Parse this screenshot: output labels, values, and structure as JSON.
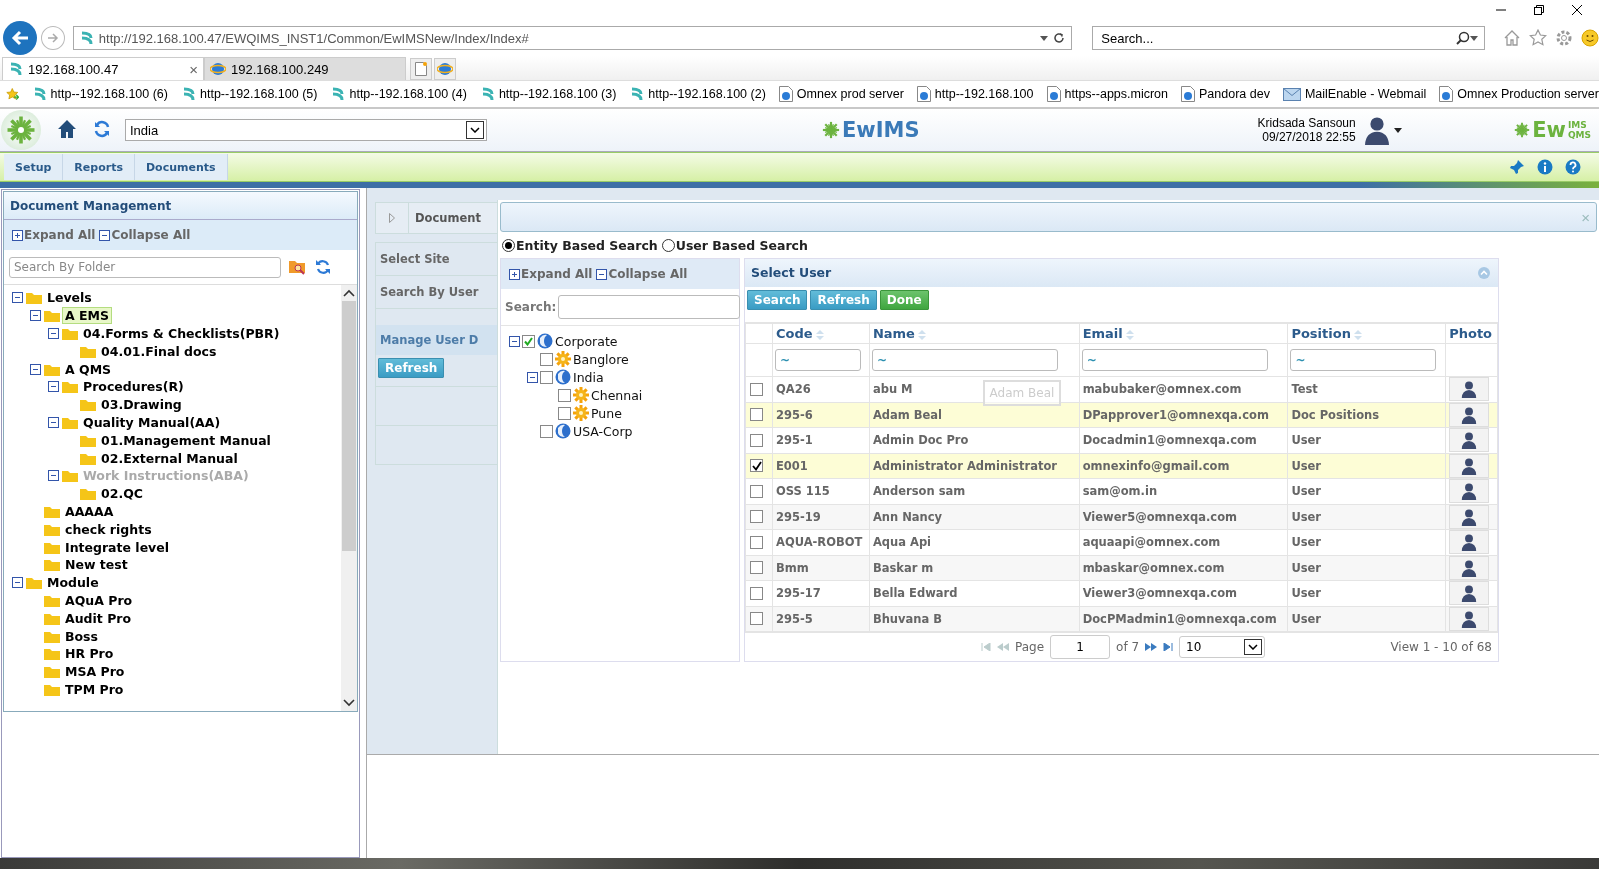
{
  "browser": {
    "address": "http://192.168.100.47/EWQIMS_INST1/Common/EwIMSNew/Index/Index#",
    "search_placeholder": "Search...",
    "tab_close": "×",
    "tabs": [
      {
        "label": "192.168.100.47",
        "selected": true
      },
      {
        "label": "192.168.100.249",
        "selected": false
      }
    ],
    "favorites": [
      {
        "label": "http--192.168.100 (6)",
        "kind": "site"
      },
      {
        "label": "http--192.168.100 (5)",
        "kind": "site"
      },
      {
        "label": "http--192.168.100 (4)",
        "kind": "site"
      },
      {
        "label": "http--192.168.100 (3)",
        "kind": "site"
      },
      {
        "label": "http--192.168.100 (2)",
        "kind": "site"
      },
      {
        "label": "Omnex prod server",
        "kind": "page"
      },
      {
        "label": "http--192.168.100",
        "kind": "page"
      },
      {
        "label": "https--apps.micron",
        "kind": "page"
      },
      {
        "label": "Pandora dev",
        "kind": "page"
      },
      {
        "label": "MailEnable - Webmail",
        "kind": "mail"
      },
      {
        "label": "Omnex Production server",
        "kind": "page"
      }
    ]
  },
  "app_header": {
    "site": "India",
    "logo": "EwIMS",
    "user_name": "Kridsada Sansoun",
    "datetime": "09/27/2018 22:55",
    "corner_logo": {
      "main": "Ew",
      "top": "IMS",
      "bottom": "QMS"
    }
  },
  "menu": [
    {
      "label": "Setup"
    },
    {
      "label": "Reports"
    },
    {
      "label": "Documents"
    }
  ],
  "left_panel": {
    "title": "Document Management",
    "expand_all": "Expand All",
    "collapse_all": "Collapse All",
    "search_placeholder": "Search By Folder",
    "tree": [
      {
        "label": "Levels",
        "selected": false,
        "disabled": false,
        "children": [
          {
            "label": "A EMS",
            "selected": true,
            "disabled": false,
            "children": [
              {
                "label": "04.Forms & Checklists(PBR)",
                "selected": false,
                "disabled": false,
                "children": [
                  {
                    "label": "04.01.Final docs",
                    "selected": false,
                    "disabled": false
                  }
                ]
              }
            ]
          },
          {
            "label": "A QMS",
            "selected": false,
            "disabled": false,
            "children": [
              {
                "label": "Procedures(R)",
                "selected": false,
                "disabled": false,
                "children": [
                  {
                    "label": "03.Drawing",
                    "selected": false,
                    "disabled": false
                  }
                ]
              },
              {
                "label": "Quality Manual(AA)",
                "selected": false,
                "disabled": false,
                "children": [
                  {
                    "label": "01.Management Manual",
                    "selected": false,
                    "disabled": false
                  },
                  {
                    "label": "02.External Manual",
                    "selected": false,
                    "disabled": false
                  }
                ]
              },
              {
                "label": "Work Instructions(ABA)",
                "selected": false,
                "disabled": true,
                "children": [
                  {
                    "label": "02.QC",
                    "selected": false,
                    "disabled": false
                  }
                ]
              }
            ]
          },
          {
            "label": "AAAAA",
            "selected": false,
            "disabled": false
          },
          {
            "label": "check rights",
            "selected": false,
            "disabled": false
          },
          {
            "label": "Integrate level",
            "selected": false,
            "disabled": false
          },
          {
            "label": "New test",
            "selected": false,
            "disabled": false
          }
        ]
      },
      {
        "label": "Module",
        "selected": false,
        "disabled": false,
        "children": [
          {
            "label": "AQuA Pro",
            "selected": false,
            "disabled": false
          },
          {
            "label": "Audit Pro",
            "selected": false,
            "disabled": false
          },
          {
            "label": "Boss",
            "selected": false,
            "disabled": false
          },
          {
            "label": "HR Pro",
            "selected": false,
            "disabled": false
          },
          {
            "label": "MSA Pro",
            "selected": false,
            "disabled": false
          },
          {
            "label": "TPM Pro",
            "selected": false,
            "disabled": false
          }
        ]
      }
    ]
  },
  "side_nav": {
    "header": "Document",
    "items": [
      {
        "label": "Select Site"
      },
      {
        "label": "Search By User"
      }
    ],
    "section": "Manage User D",
    "refresh": "Refresh"
  },
  "dialog_close": "×",
  "search_modes": [
    {
      "label": "Entity Based Search",
      "selected": true
    },
    {
      "label": "User Based Search",
      "selected": false
    }
  ],
  "entity_tree": {
    "expand_all": "Expand All",
    "collapse_all": "Collapse All",
    "search_label": "Search:",
    "items": [
      {
        "label": "Corporate",
        "kind": "globe",
        "checked": true,
        "children": [
          {
            "label": "Banglore",
            "kind": "gear",
            "checked": false
          },
          {
            "label": "India",
            "kind": "globe",
            "checked": false,
            "children": [
              {
                "label": "Chennai",
                "kind": "gear",
                "checked": false
              },
              {
                "label": "Pune",
                "kind": "gear",
                "checked": false
              }
            ]
          },
          {
            "label": "USA-Corp",
            "kind": "globe",
            "checked": false
          }
        ]
      }
    ]
  },
  "user_grid": {
    "title": "Select User",
    "buttons": [
      {
        "label": "Search",
        "kind": "primary"
      },
      {
        "label": "Refresh",
        "kind": "primary"
      },
      {
        "label": "Done",
        "kind": "success"
      }
    ],
    "columns": [
      {
        "label": "Code",
        "sortable": true,
        "filter": "~"
      },
      {
        "label": "Name",
        "sortable": true,
        "filter": "~"
      },
      {
        "label": "Email",
        "sortable": true,
        "filter": "~"
      },
      {
        "label": "Position",
        "sortable": true,
        "filter": "~"
      },
      {
        "label": "Photo",
        "sortable": false
      }
    ],
    "rows": [
      {
        "code": "QA26",
        "name": "abu M",
        "email": "mabubaker@omnex.com",
        "position": "Test",
        "checked": false,
        "highlighted": false
      },
      {
        "code": "295-6",
        "name": "Adam Beal",
        "email": "DPapprover1@omnexqa.com",
        "position": "Doc Positions",
        "checked": false,
        "highlighted": true
      },
      {
        "code": "295-1",
        "name": "Admin Doc Pro",
        "email": "Docadmin1@omnexqa.com",
        "position": "User",
        "checked": false,
        "highlighted": false
      },
      {
        "code": "E001",
        "name": "Administrator Administrator",
        "email": "omnexinfo@gmail.com",
        "position": "User",
        "checked": true,
        "highlighted": true
      },
      {
        "code": "OSS 115",
        "name": "Anderson sam",
        "email": "sam@om.in",
        "position": "User",
        "checked": false,
        "highlighted": false
      },
      {
        "code": "295-19",
        "name": "Ann Nancy",
        "email": "Viewer5@omnexqa.com",
        "position": "User",
        "checked": false,
        "highlighted": false
      },
      {
        "code": "AQUA-ROBOT",
        "name": "Aqua Api",
        "email": "aquaapi@omnex.com",
        "position": "User",
        "checked": false,
        "highlighted": false
      },
      {
        "code": "Bmm",
        "name": "Baskar m",
        "email": "mbaskar@omnex.com",
        "position": "User",
        "checked": false,
        "highlighted": false
      },
      {
        "code": "295-17",
        "name": "Bella  Edward",
        "email": "Viewer3@omnexqa.com",
        "position": "User",
        "checked": false,
        "highlighted": false
      },
      {
        "code": "295-5",
        "name": "Bhuvana  B",
        "email": "DocPMadmin1@omnexqa.com",
        "position": "User",
        "checked": false,
        "highlighted": false
      }
    ],
    "drag_ghost": "Adam Beal",
    "pager": {
      "page_label": "Page",
      "page": "1",
      "of": "of 7",
      "page_size": "10",
      "summary": "View 1 - 10 of 68"
    }
  }
}
